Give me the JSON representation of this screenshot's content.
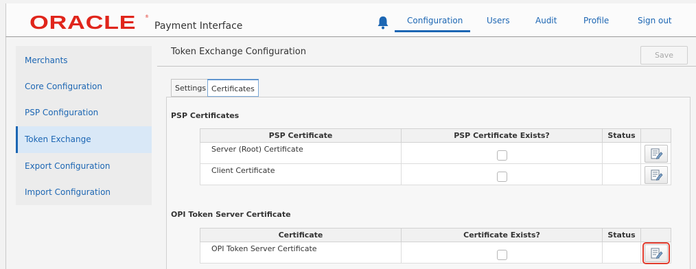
{
  "header": {
    "logo_text": "ORACLE",
    "logo_tm": "®",
    "app_name": "Payment Interface",
    "nav": {
      "configuration": "Configuration",
      "users": "Users",
      "audit": "Audit",
      "profile": "Profile",
      "sign_out": "Sign out"
    }
  },
  "sidebar": {
    "items": [
      {
        "label": "Merchants"
      },
      {
        "label": "Core Configuration"
      },
      {
        "label": "PSP Configuration"
      },
      {
        "label": "Token Exchange"
      },
      {
        "label": "Export Configuration"
      },
      {
        "label": "Import Configuration"
      }
    ],
    "active": "Token Exchange"
  },
  "main": {
    "title": "Token Exchange Configuration",
    "save_label": "Save",
    "tabs": [
      {
        "label": "Settings"
      },
      {
        "label": "Certificates"
      }
    ],
    "active_tab": "Certificates",
    "psp_section": {
      "title": "PSP Certificates",
      "columns": [
        "PSP Certificate",
        "PSP Certificate Exists?",
        "Status"
      ],
      "rows": [
        {
          "name": "Server (Root) Certificate",
          "exists": false,
          "status": ""
        },
        {
          "name": "Client Certificate",
          "exists": false,
          "status": ""
        }
      ]
    },
    "opi_section": {
      "title": "OPI Token Server Certificate",
      "columns": [
        "Certificate",
        "Certificate Exists?",
        "Status"
      ],
      "rows": [
        {
          "name": "OPI Token Server Certificate",
          "exists": false,
          "status": ""
        }
      ]
    }
  },
  "colors": {
    "brand_red": "#e0251b",
    "link_blue": "#1c66b3",
    "highlight_red": "#e03a2c"
  },
  "icons": {
    "bell": "bell-icon",
    "edit": "edit-document-icon"
  }
}
